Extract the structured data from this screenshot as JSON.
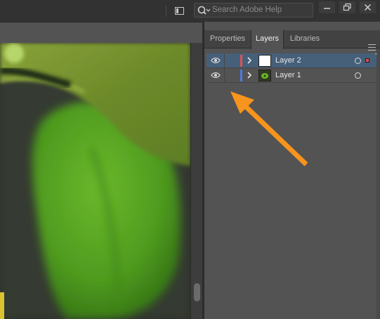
{
  "search": {
    "placeholder": "Search Adobe Help"
  },
  "panel": {
    "tabs": [
      {
        "label": "Properties",
        "active": false
      },
      {
        "label": "Layers",
        "active": true
      },
      {
        "label": "Libraries",
        "active": false
      }
    ],
    "layers": [
      {
        "name": "Layer 2",
        "color": "#e05252",
        "selected": true,
        "visible": true
      },
      {
        "name": "Layer 1",
        "color": "#4d7be0",
        "selected": false,
        "visible": true
      }
    ]
  },
  "colors": {
    "accent_arrow": "#f7941d",
    "selected_row": "#46607a",
    "panel_bg": "#535353"
  }
}
